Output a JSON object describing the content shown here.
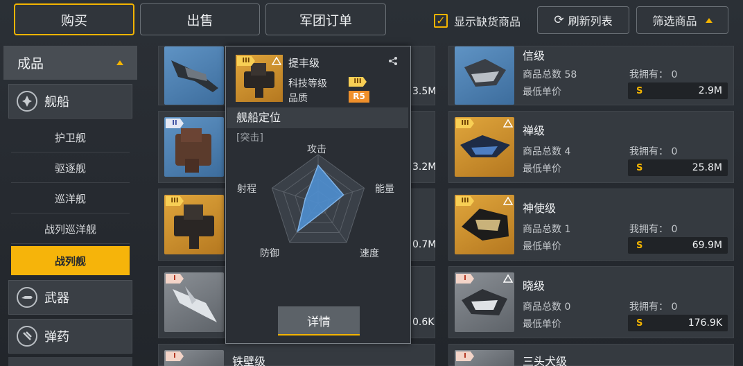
{
  "tabs": {
    "buy": "购买",
    "sell": "出售",
    "legion_orders": "军团订单"
  },
  "toolbar": {
    "show_out_of_stock": "显示缺货商品",
    "refresh": "刷新列表",
    "filter": "筛选商品"
  },
  "sidebar": {
    "category": "成品",
    "ships": "舰船",
    "ship_types": [
      "护卫舰",
      "驱逐舰",
      "巡洋舰",
      "战列巡洋舰",
      "战列舰"
    ],
    "weapons": "武器",
    "ammo": "弹药"
  },
  "list_labels": {
    "total_prefix": "商品总数",
    "own": "我拥有：",
    "lowest_price": "最低单价",
    "coin": "S"
  },
  "left_column": {
    "prices": [
      "3.5M",
      "3.2M",
      "0.7M",
      "0.6K"
    ],
    "bottom_name": "铁壁级",
    "tiers": [
      "III",
      "II",
      "III",
      "I",
      "I"
    ]
  },
  "right_column": [
    {
      "name": "信级",
      "count": "58",
      "own": "0",
      "price": "2.9M",
      "tier": "III"
    },
    {
      "name": "禅级",
      "count": "4",
      "own": "0",
      "price": "25.8M",
      "tier": "III"
    },
    {
      "name": "神使级",
      "count": "1",
      "own": "0",
      "price": "69.9M",
      "tier": "III"
    },
    {
      "name": "晓级",
      "count": "0",
      "own": "0",
      "price": "176.9K",
      "tier": "I"
    },
    {
      "name": "三头犬级",
      "tier": "I"
    }
  ],
  "popup": {
    "name": "提丰级",
    "tech_level_label": "科技等级",
    "tech_level": "III",
    "quality_label": "品质",
    "quality": "R5",
    "role_title": "舰船定位",
    "role_value": "[突击]",
    "radar": {
      "labels": [
        "攻击",
        "能量",
        "速度",
        "防御",
        "射程"
      ],
      "values": [
        0.78,
        0.55,
        0.2,
        0.72,
        0.28
      ]
    },
    "details": "详情"
  },
  "colors": {
    "accent": "#f6b40a",
    "radar_fill": "#4f8fd0"
  }
}
